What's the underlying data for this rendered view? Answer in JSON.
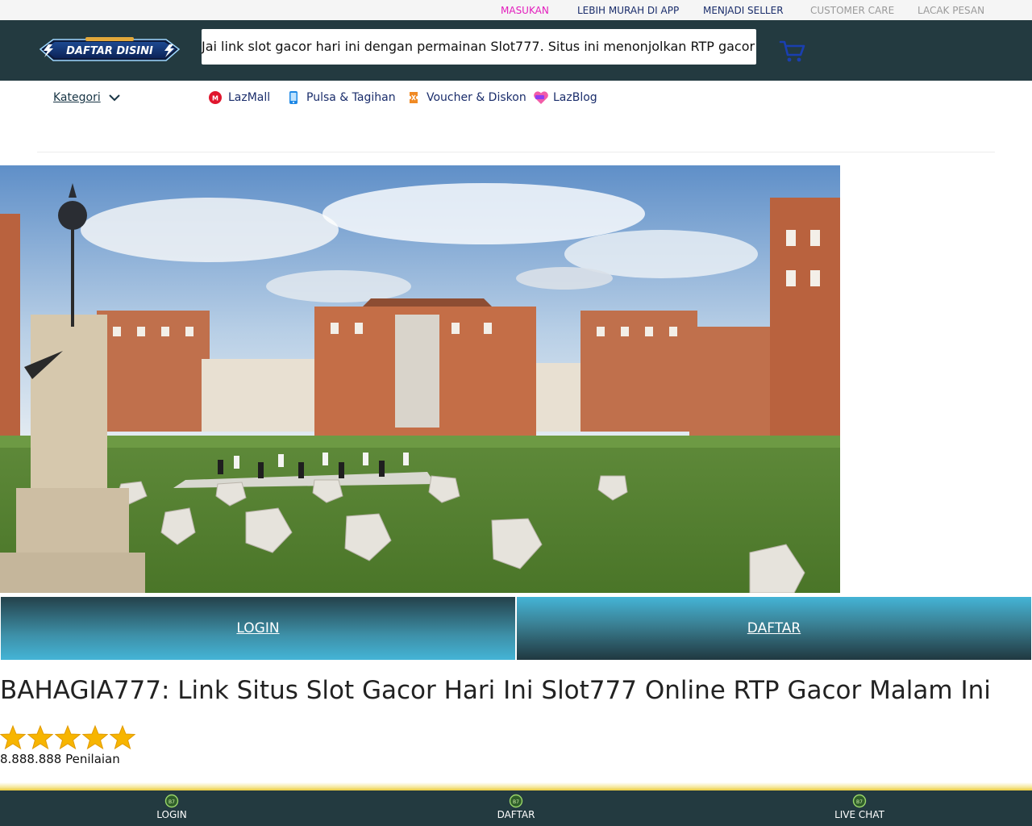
{
  "topbar": {
    "links": [
      {
        "label": "MASUKAN",
        "color": "#e31ebd"
      },
      {
        "label": "LEBIH MURAH DI APP",
        "color": "#1a2d6b"
      },
      {
        "label": "MENJADI SELLER",
        "color": "#1a2d6b"
      },
      {
        "label": "CUSTOMER CARE",
        "color": "#9a9a9a"
      },
      {
        "label": "LACAK PESAN",
        "color": "#9a9a9a"
      }
    ]
  },
  "header": {
    "logo_text": "DAFTAR DISINI",
    "search_text": "Jai link slot gacor hari ini dengan permainan Slot777. Situs ini menonjolkan RTP gacor tertinggi",
    "cart_icon": "cart-icon"
  },
  "catnav": {
    "kategori_label": "Kategori",
    "links": [
      {
        "label": "LazMall",
        "icon": "lazmall-icon"
      },
      {
        "label": "Pulsa & Tagihan",
        "icon": "phone-icon"
      },
      {
        "label": "Voucher & Diskon",
        "icon": "voucher-icon"
      },
      {
        "label": "LazBlog",
        "icon": "blog-heart-icon"
      }
    ]
  },
  "buttons": {
    "login": "LOGIN",
    "daftar": "DAFTAR"
  },
  "product": {
    "title": "BAHAGIA777: Link Situs Slot Gacor Hari Ini Slot777 Online RTP Gacor Malam Ini",
    "stars": 5,
    "rating_text": "8.888.888 Penilaian"
  },
  "bottomnav": {
    "items": [
      {
        "label": "LOGIN"
      },
      {
        "label": "DAFTAR"
      },
      {
        "label": "LIVE CHAT"
      }
    ]
  }
}
